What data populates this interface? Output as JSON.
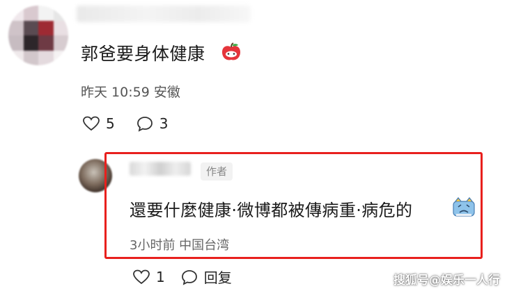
{
  "comment": {
    "text": "郭爸要身体健康",
    "emoji": "apple-icon",
    "time": "昨天 10:59 安徽",
    "likes": "5",
    "replies": "3"
  },
  "reply": {
    "badge": "作者",
    "text": "還要什麼健康·微博都被傳病重·病危的",
    "emoji": "sad-face-icon",
    "time": "3小时前 中国台湾",
    "likes": "1",
    "reply_label": "回复"
  },
  "colors": {
    "highlight_border": "#e8201d",
    "meta_text": "#555555"
  },
  "watermark": "搜狐号@娱乐一人行"
}
